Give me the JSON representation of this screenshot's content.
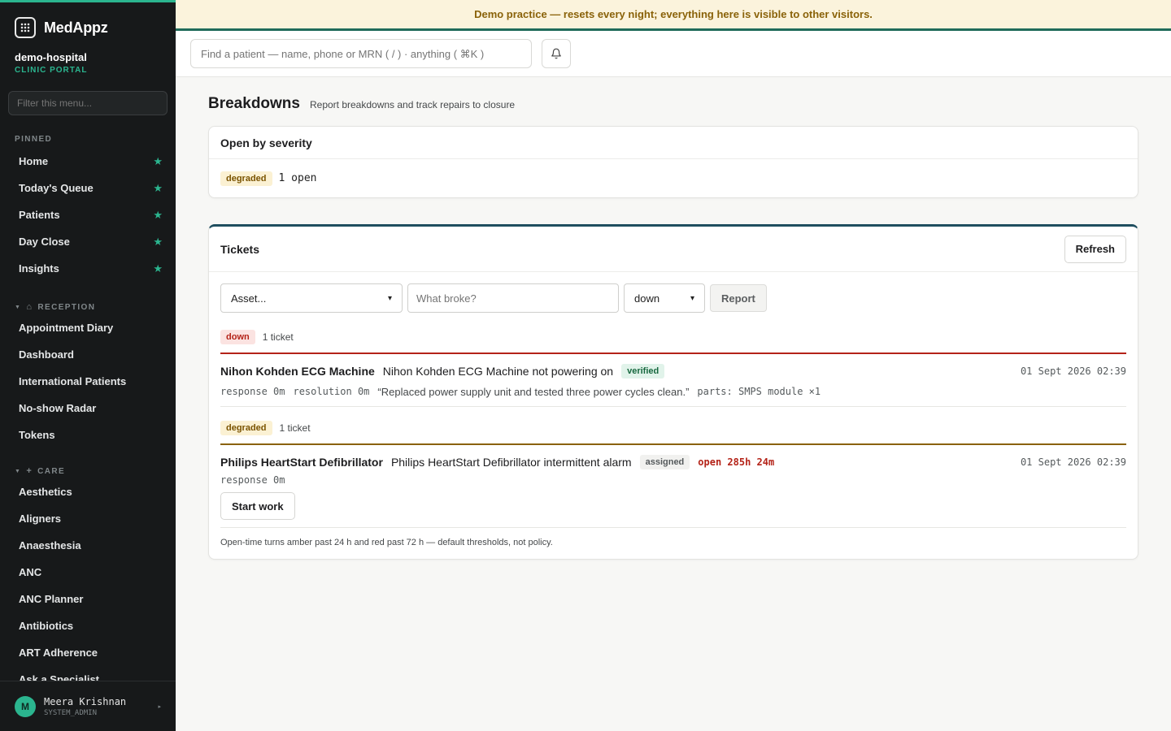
{
  "app": {
    "name": "MedAppz",
    "org_name": "demo-hospital",
    "org_sub": "CLINIC PORTAL"
  },
  "banner": {
    "text": "Demo practice — resets every night; everything here is visible to other visitors."
  },
  "topbar": {
    "search_placeholder": "Find a patient — name, phone or MRN ( / ) · anything ( ⌘K )"
  },
  "sidebar": {
    "filter_placeholder": "Filter this menu...",
    "pinned_label": "PINNED",
    "pinned": [
      {
        "label": "Home"
      },
      {
        "label": "Today's Queue"
      },
      {
        "label": "Patients"
      },
      {
        "label": "Day Close"
      },
      {
        "label": "Insights"
      }
    ],
    "reception_label": "RECEPTION",
    "reception": [
      {
        "label": "Appointment Diary"
      },
      {
        "label": "Dashboard"
      },
      {
        "label": "International Patients"
      },
      {
        "label": "No-show Radar"
      },
      {
        "label": "Tokens"
      }
    ],
    "care_label": "CARE",
    "care": [
      {
        "label": "Aesthetics"
      },
      {
        "label": "Aligners"
      },
      {
        "label": "Anaesthesia"
      },
      {
        "label": "ANC"
      },
      {
        "label": "ANC Planner"
      },
      {
        "label": "Antibiotics"
      },
      {
        "label": "ART Adherence"
      },
      {
        "label": "Ask a Specialist"
      }
    ],
    "user": {
      "initial": "M",
      "name": "Meera Krishnan",
      "role": "SYSTEM_ADMIN"
    }
  },
  "page": {
    "title": "Breakdowns",
    "subtitle": "Report breakdowns and track repairs to closure"
  },
  "severity_card": {
    "title": "Open by severity",
    "badge": "degraded",
    "count": "1 open"
  },
  "tickets": {
    "title": "Tickets",
    "refresh_label": "Refresh",
    "asset_select": "Asset...",
    "what_placeholder": "What broke?",
    "severity_select": "down",
    "report_label": "Report",
    "groups": [
      {
        "badge": "down",
        "count": "1 ticket",
        "ticket": {
          "asset": "Nihon Kohden ECG Machine",
          "issue": "Nihon Kohden ECG Machine not powering on",
          "status": "verified",
          "timestamp": "01 Sept 2026 02:39",
          "response": "response 0m",
          "resolution": "resolution 0m",
          "note": "“Replaced power supply unit and tested three power cycles clean.”",
          "parts": "parts: SMPS module ×1"
        }
      },
      {
        "badge": "degraded",
        "count": "1 ticket",
        "ticket": {
          "asset": "Philips HeartStart Defibrillator",
          "issue": "Philips HeartStart Defibrillator intermittent alarm",
          "status": "assigned",
          "open_age": "open 285h 24m",
          "timestamp": "01 Sept 2026 02:39",
          "response": "response 0m",
          "action_label": "Start work"
        }
      }
    ],
    "footnote": "Open-time turns amber past 24 h and red past 72 h — default thresholds, not policy."
  },
  "colors": {
    "accent": "#2bb58f",
    "sidebar_bg": "#17191a",
    "down": "#b42318",
    "degraded": "#8a6209"
  }
}
